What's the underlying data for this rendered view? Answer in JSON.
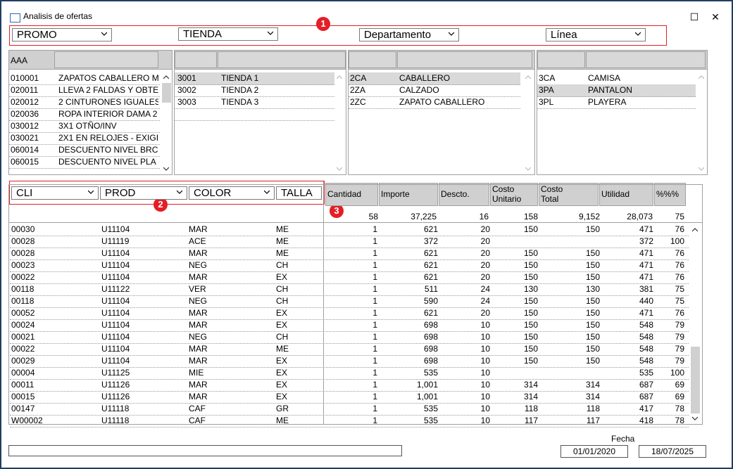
{
  "window": {
    "title": "Analisis de ofertas",
    "maximize_glyph": "☐",
    "close_glyph": "✕"
  },
  "badges": [
    "1",
    "2",
    "3"
  ],
  "filters": {
    "promo": "PROMO",
    "tienda": "TIENDA",
    "departamento": "Departamento",
    "linea": "Línea"
  },
  "promo_panel": {
    "header": "AAA",
    "rows": [
      {
        "code": "010001",
        "desc": "ZAPATOS CABALLERO M"
      },
      {
        "code": "020011",
        "desc": "LLEVA 2 FALDAS Y OBTE"
      },
      {
        "code": "020012",
        "desc": "2 CINTURONES IGUALES"
      },
      {
        "code": "020036",
        "desc": "ROPA INTERIOR DAMA 2"
      },
      {
        "code": "030012",
        "desc": "3X1 OTÑO/INV"
      },
      {
        "code": "030021",
        "desc": "2X1 EN RELOJES - EXIGI"
      },
      {
        "code": "060014",
        "desc": "DESCUENTO NIVEL BRC"
      },
      {
        "code": "060015",
        "desc": "DESCUENTO NIVEL PLA"
      }
    ]
  },
  "tienda_panel": {
    "rows": [
      {
        "code": "3001",
        "desc": "TIENDA 1"
      },
      {
        "code": "3002",
        "desc": "TIENDA 2"
      },
      {
        "code": "3003",
        "desc": "TIENDA 3"
      }
    ]
  },
  "depto_panel": {
    "rows": [
      {
        "code": "2CA",
        "desc": "CABALLERO"
      },
      {
        "code": "2ZA",
        "desc": "CALZADO"
      },
      {
        "code": "2ZC",
        "desc": "ZAPATO CABALLERO"
      }
    ]
  },
  "linea_panel": {
    "rows": [
      {
        "code": "3CA",
        "desc": "CAMISA"
      },
      {
        "code": "3PA",
        "desc": "PANTALON"
      },
      {
        "code": "3PL",
        "desc": "PLAYERA"
      }
    ]
  },
  "grid_filters": {
    "cli": "CLI",
    "prod": "PROD",
    "color": "COLOR",
    "talla": "TALLA"
  },
  "columns": {
    "cantidad": "Cantidad",
    "importe": "Importe",
    "descto": "Descto.",
    "costo_unitario": [
      "Costo",
      "Unitario"
    ],
    "costo_total": [
      "Costo",
      "Total"
    ],
    "utilidad": "Utilidad",
    "pct": "%%%"
  },
  "totals": {
    "cantidad": "58",
    "importe": "37,225",
    "descto": "16",
    "costo_unitario": "158",
    "costo_total": "9,152",
    "utilidad": "28,073",
    "pct": "75"
  },
  "rows": [
    {
      "cli": "00030",
      "prod": "U11104",
      "color": "MAR",
      "talla": "ME",
      "cant": "1",
      "imp": "621",
      "desc": "20",
      "cu": "150",
      "ct": "150",
      "util": "471",
      "pct": "76"
    },
    {
      "cli": "00028",
      "prod": "U11119",
      "color": "ACE",
      "talla": "ME",
      "cant": "1",
      "imp": "372",
      "desc": "20",
      "cu": "",
      "ct": "",
      "util": "372",
      "pct": "100"
    },
    {
      "cli": "00028",
      "prod": "U11104",
      "color": "MAR",
      "talla": "ME",
      "cant": "1",
      "imp": "621",
      "desc": "20",
      "cu": "150",
      "ct": "150",
      "util": "471",
      "pct": "76"
    },
    {
      "cli": "00023",
      "prod": "U11104",
      "color": "NEG",
      "talla": "CH",
      "cant": "1",
      "imp": "621",
      "desc": "20",
      "cu": "150",
      "ct": "150",
      "util": "471",
      "pct": "76"
    },
    {
      "cli": "00022",
      "prod": "U11104",
      "color": "MAR",
      "talla": "EX",
      "cant": "1",
      "imp": "621",
      "desc": "20",
      "cu": "150",
      "ct": "150",
      "util": "471",
      "pct": "76"
    },
    {
      "cli": "00118",
      "prod": "U11122",
      "color": "VER",
      "talla": "CH",
      "cant": "1",
      "imp": "511",
      "desc": "24",
      "cu": "130",
      "ct": "130",
      "util": "381",
      "pct": "75"
    },
    {
      "cli": "00118",
      "prod": "U11104",
      "color": "NEG",
      "talla": "CH",
      "cant": "1",
      "imp": "590",
      "desc": "24",
      "cu": "150",
      "ct": "150",
      "util": "440",
      "pct": "75"
    },
    {
      "cli": "00052",
      "prod": "U11104",
      "color": "MAR",
      "talla": "EX",
      "cant": "1",
      "imp": "621",
      "desc": "20",
      "cu": "150",
      "ct": "150",
      "util": "471",
      "pct": "76"
    },
    {
      "cli": "00024",
      "prod": "U11104",
      "color": "MAR",
      "talla": "EX",
      "cant": "1",
      "imp": "698",
      "desc": "10",
      "cu": "150",
      "ct": "150",
      "util": "548",
      "pct": "79"
    },
    {
      "cli": "00021",
      "prod": "U11104",
      "color": "NEG",
      "talla": "CH",
      "cant": "1",
      "imp": "698",
      "desc": "10",
      "cu": "150",
      "ct": "150",
      "util": "548",
      "pct": "79"
    },
    {
      "cli": "00022",
      "prod": "U11104",
      "color": "MAR",
      "talla": "ME",
      "cant": "1",
      "imp": "698",
      "desc": "10",
      "cu": "150",
      "ct": "150",
      "util": "548",
      "pct": "79"
    },
    {
      "cli": "00029",
      "prod": "U11104",
      "color": "MAR",
      "talla": "EX",
      "cant": "1",
      "imp": "698",
      "desc": "10",
      "cu": "150",
      "ct": "150",
      "util": "548",
      "pct": "79"
    },
    {
      "cli": "00004",
      "prod": "U11125",
      "color": "MIE",
      "talla": "EX",
      "cant": "1",
      "imp": "535",
      "desc": "10",
      "cu": "",
      "ct": "",
      "util": "535",
      "pct": "100"
    },
    {
      "cli": "00011",
      "prod": "U11126",
      "color": "MAR",
      "talla": "EX",
      "cant": "1",
      "imp": "1,001",
      "desc": "10",
      "cu": "314",
      "ct": "314",
      "util": "687",
      "pct": "69"
    },
    {
      "cli": "00015",
      "prod": "U11126",
      "color": "MAR",
      "talla": "EX",
      "cant": "1",
      "imp": "1,001",
      "desc": "10",
      "cu": "314",
      "ct": "314",
      "util": "687",
      "pct": "69"
    },
    {
      "cli": "00147",
      "prod": "U11118",
      "color": "CAF",
      "talla": "GR",
      "cant": "1",
      "imp": "535",
      "desc": "10",
      "cu": "118",
      "ct": "118",
      "util": "417",
      "pct": "78"
    },
    {
      "cli": "W00002",
      "prod": "U11118",
      "color": "CAF",
      "talla": "ME",
      "cant": "1",
      "imp": "535",
      "desc": "10",
      "cu": "117",
      "ct": "117",
      "util": "418",
      "pct": "78"
    }
  ],
  "footer": {
    "fecha_label": "Fecha",
    "fecha_desde": "01/01/2020",
    "fecha_hasta": "18/07/2025",
    "status": ""
  },
  "colors": {
    "frame": "#1f3d63",
    "highlight": "#e41e26",
    "header_gray": "#d0d0d0"
  }
}
